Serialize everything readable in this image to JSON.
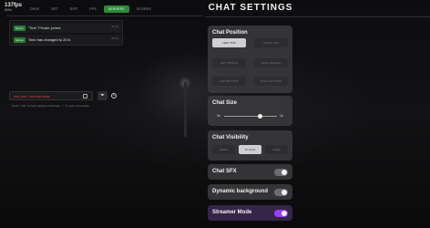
{
  "hud": {
    "fps_value": "137fps",
    "fps_sub": "60Hz"
  },
  "nav": {
    "tabs": [
      {
        "label": "Desk",
        "active": false
      },
      {
        "label": "Set",
        "active": false
      },
      {
        "label": "Diff",
        "active": false
      },
      {
        "label": "FPS",
        "active": false
      },
      {
        "label": "Servers",
        "active": true
      },
      {
        "label": "Scores",
        "active": false
      }
    ]
  },
  "chat": {
    "messages": [
      {
        "badge": "Server",
        "text": "\"Test\" Private joined.",
        "time": "00:12",
        "color": "green"
      },
      {
        "badge": "Server",
        "text": "Time has changed to 20:0.",
        "time": "00:13",
        "color": "white"
      }
    ],
    "input_placeholder": "Add your / info chat ideas",
    "hint": "Press \" Ctrl\" to cycle between channels, \" / \" to open commands"
  },
  "settings": {
    "title": "CHAT SETTINGS",
    "position": {
      "title": "Chat Position",
      "options": [
        "Left Top",
        "Right Top",
        "Left Middle",
        "Right Middle",
        "Left Bottom",
        "Right Bottom"
      ],
      "selected": "Left Top"
    },
    "size": {
      "title": "Chat Size",
      "min_label": "0s",
      "max_label": "1s",
      "value_fraction": 0.68
    },
    "visibility": {
      "title": "Chat Visibility",
      "options": [
        "Hidden",
        "On Input",
        "Visible"
      ],
      "selected": "On Input"
    },
    "sfx": {
      "title": "Chat SFX",
      "on": false
    },
    "dynamic_bg": {
      "title": "Dynamic background",
      "on": false
    },
    "streamer_mode": {
      "title": "Streamer Mode",
      "on": true
    }
  },
  "colors": {
    "accent_green": "#2d8a3a",
    "accent_purple": "#9b3df0",
    "error_red": "#d14545"
  }
}
